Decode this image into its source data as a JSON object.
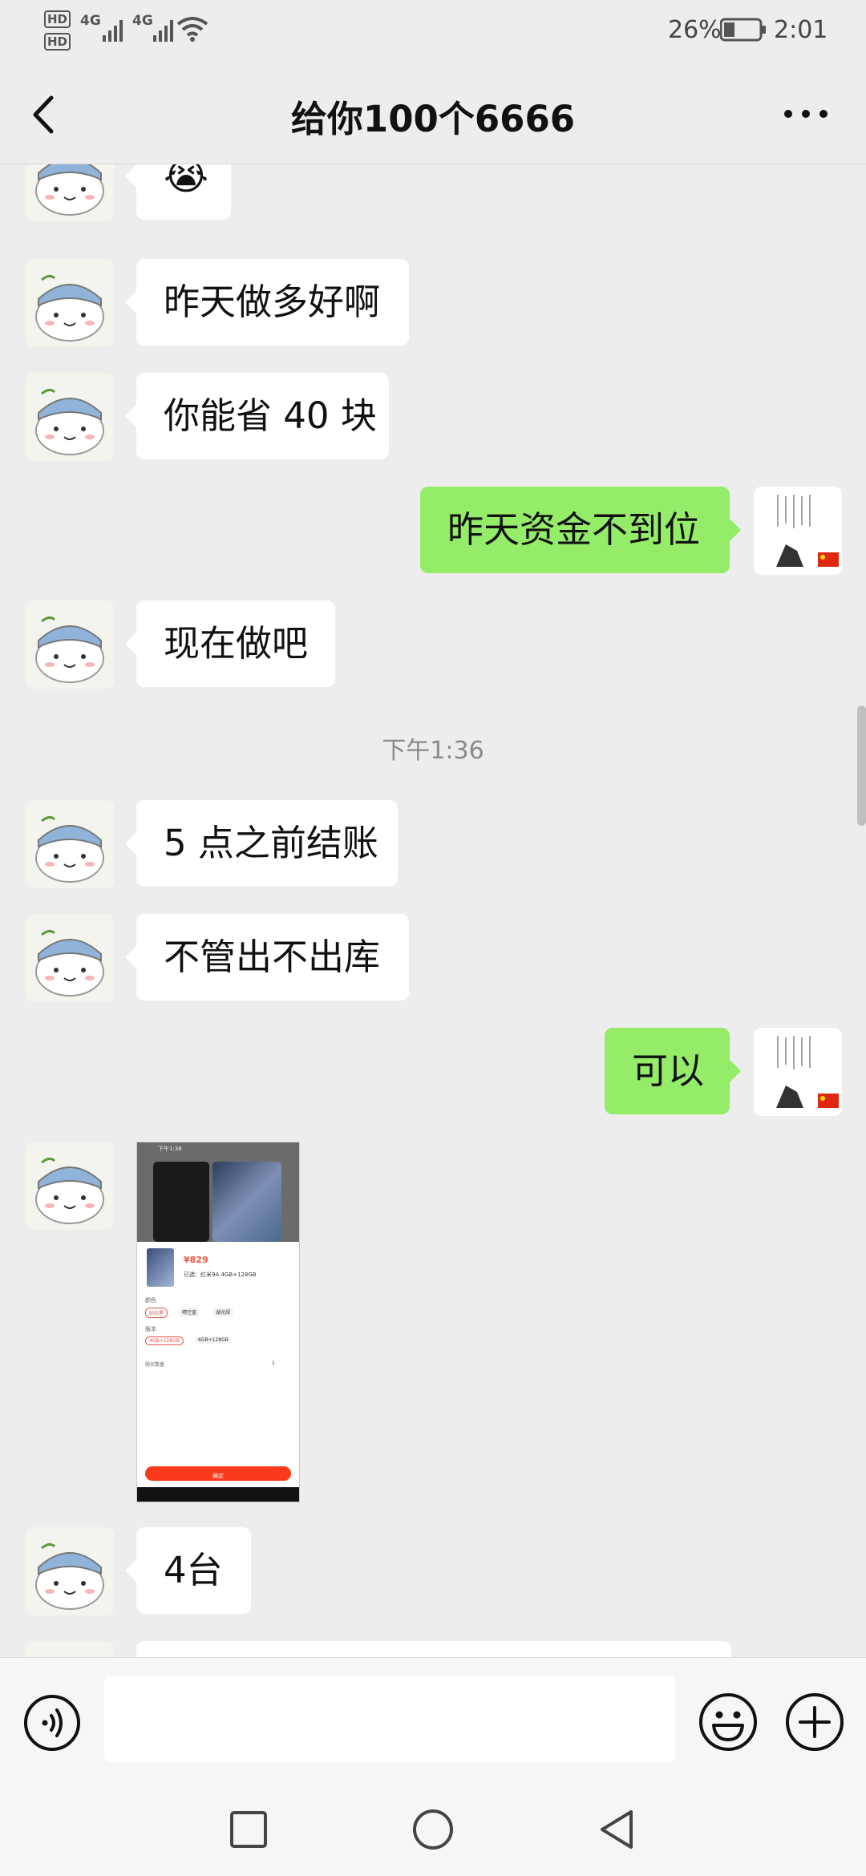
{
  "status_bar": {
    "hd1": "HD",
    "hd2": "HD",
    "net1": "4G",
    "net2": "4G",
    "battery_percent": "26%",
    "time": "2:01"
  },
  "header": {
    "title": "给你100个6666"
  },
  "messages": [
    {
      "side": "in",
      "text": "😭"
    },
    {
      "side": "in",
      "text": "昨天做多好啊"
    },
    {
      "side": "in",
      "text": "你能省 40 块"
    },
    {
      "side": "out",
      "text": "昨天资金不到位"
    },
    {
      "side": "in",
      "text": "现在做吧"
    },
    {
      "side": "in",
      "text": "5 点之前结账"
    },
    {
      "side": "in",
      "text": "不管出不出库"
    },
    {
      "side": "out",
      "text": "可以"
    },
    {
      "side": "in",
      "text": "4台"
    }
  ],
  "timestamp": "下午1:36",
  "screenshot_message": {
    "status_time": "下午1:38",
    "price": "¥829",
    "product": "已选：红米9A 4GB+128GB",
    "section_color": "颜色",
    "color_options": [
      "砂石黑",
      "晴空蓝",
      "湖光绿"
    ],
    "section_version": "版本",
    "version_options": [
      "4GB+128GB",
      "6GB+128GB"
    ],
    "quantity_label": "购买数量",
    "quantity": "1",
    "confirm_label": "确定"
  },
  "colors": {
    "background": "#ededed",
    "incoming_bubble": "#ffffff",
    "outgoing_bubble": "#95ec69",
    "buy_button": "#fa3a1a"
  }
}
